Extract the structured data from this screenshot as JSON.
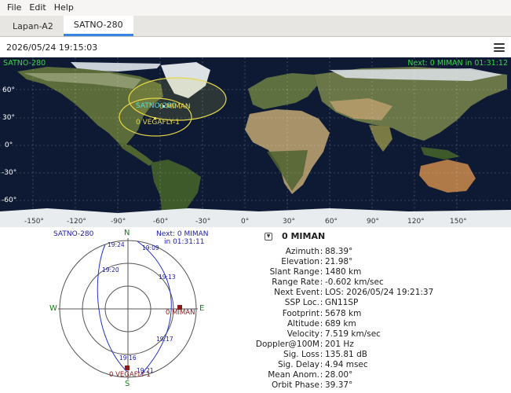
{
  "menu": {
    "items": [
      "File",
      "Edit",
      "Help"
    ]
  },
  "tabs": [
    {
      "label": "Lapan-A2",
      "active": false
    },
    {
      "label": "SATNO-280",
      "active": true
    }
  ],
  "header": {
    "datetime": "2026/05/24 19:15:03"
  },
  "map": {
    "satellite_label": "SATNO-280",
    "next_event": "Next: 0 MIMAN in 01:31:12",
    "lat_labels": [
      "60°",
      "30°",
      "0°",
      "-30°",
      "-60°"
    ],
    "lon_labels": [
      "-150°",
      "-120°",
      "-90°",
      "-60°",
      "-30°",
      "0°",
      "30°",
      "60°",
      "90°",
      "120°",
      "150°"
    ],
    "sat_markers": [
      "SATNO-280",
      "0 MIMAN",
      "0 VEGAFLY-1"
    ],
    "colors": {
      "ocean": "#0e1a33",
      "land": "#5b6b3a",
      "desert": "#a8926a",
      "ice": "#e8ecef",
      "footprint": "#e6d84a",
      "grid": "#ffffff",
      "label_green": "#39d84a"
    }
  },
  "polar": {
    "title": "SATNO-280",
    "next_line1": "Next: 0 MIMAN",
    "next_line2": "in 01:31:11",
    "directions": {
      "n": "N",
      "s": "S",
      "e": "E",
      "w": "W"
    },
    "times": [
      "19:24",
      "19:09",
      "19:20",
      "19:13",
      "19:17",
      "19:16",
      "19:21"
    ],
    "markers": [
      "0 MIMAN",
      "0 VEGAFLY-1"
    ],
    "colors": {
      "axes": "#555555",
      "track": "#2233cc",
      "marker": "#8b1a1a"
    }
  },
  "info": {
    "title": "0 MIMAN",
    "rows": [
      {
        "label": "Azimuth",
        "value": "88.39°"
      },
      {
        "label": "Elevation",
        "value": "21.98°"
      },
      {
        "label": "Slant Range",
        "value": "1480 km"
      },
      {
        "label": "Range Rate",
        "value": "-0.602 km/sec"
      },
      {
        "label": "Next Event",
        "value": "LOS: 2026/05/24 19:21:37"
      },
      {
        "label": "SSP Loc.",
        "value": "GN11SP"
      },
      {
        "label": "Footprint",
        "value": "5678 km"
      },
      {
        "label": "Altitude",
        "value": "689 km"
      },
      {
        "label": "Velocity",
        "value": "7.519 km/sec"
      },
      {
        "label": "Doppler@100M",
        "value": "201 Hz"
      },
      {
        "label": "Sig. Loss",
        "value": "135.81 dB"
      },
      {
        "label": "Sig. Delay",
        "value": "4.94 msec"
      },
      {
        "label": "Mean Anom.",
        "value": "28.00°"
      },
      {
        "label": "Orbit Phase",
        "value": "39.37°"
      }
    ]
  }
}
